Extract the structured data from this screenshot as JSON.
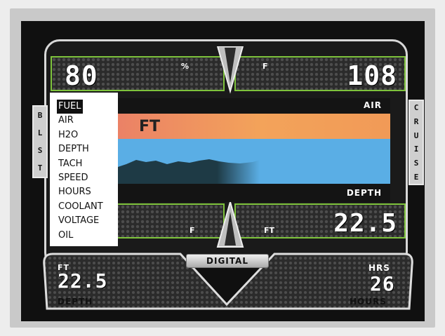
{
  "top_gauges": {
    "left_value": "80",
    "left_unit": "%",
    "right_unit": "F",
    "right_value": "108"
  },
  "strips": {
    "air_label": "AIR",
    "chart_label": "FT",
    "depth_label": "DEPTH"
  },
  "bottom_gauges": {
    "left_unit": "F",
    "right_unit": "FT",
    "right_value": "22.5"
  },
  "side_tabs": {
    "left": [
      "B",
      "L",
      "S",
      "T"
    ],
    "right": [
      "C",
      "R",
      "U",
      "I",
      "S",
      "E"
    ]
  },
  "menu": {
    "items": [
      "FUEL",
      "AIR",
      "H2O",
      "DEPTH",
      "TACH",
      "SPEED",
      "HOURS",
      "COOLANT",
      "VOLTAGE",
      "OIL"
    ],
    "selected": "FUEL"
  },
  "digital_button": {
    "label": "DIGITAL"
  },
  "footer": {
    "left_unit": "FT",
    "left_value": "22.5",
    "left_label": "DEPTH",
    "right_unit": "HRS",
    "right_value": "26",
    "right_label": "HOURS"
  },
  "colors": {
    "panel_border": "#7ec33c",
    "air_gradient_start": "#e8766a",
    "air_gradient_end": "#f3a35a",
    "water": "#5aaee5",
    "terrain": "#1e3a45"
  }
}
